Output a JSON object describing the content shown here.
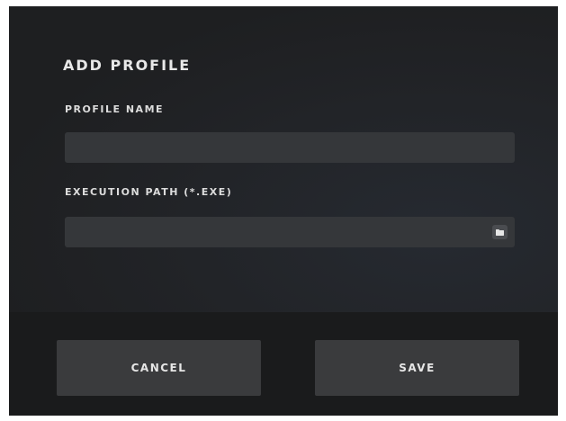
{
  "dialog": {
    "title": "ADD PROFILE",
    "profile_name": {
      "label": "PROFILE NAME",
      "value": "",
      "placeholder": ""
    },
    "execution_path": {
      "label": "EXECUTION PATH (*.EXE)",
      "value": "",
      "placeholder": "",
      "browse_icon": "folder-icon"
    },
    "buttons": {
      "cancel_label": "CANCEL",
      "save_label": "SAVE"
    }
  },
  "colors": {
    "dialog_bg": "#222428",
    "footer_bg": "#1a1b1c",
    "field_bg": "#35373a",
    "button_bg": "#3a3b3d",
    "text": "#e8e8e8"
  }
}
